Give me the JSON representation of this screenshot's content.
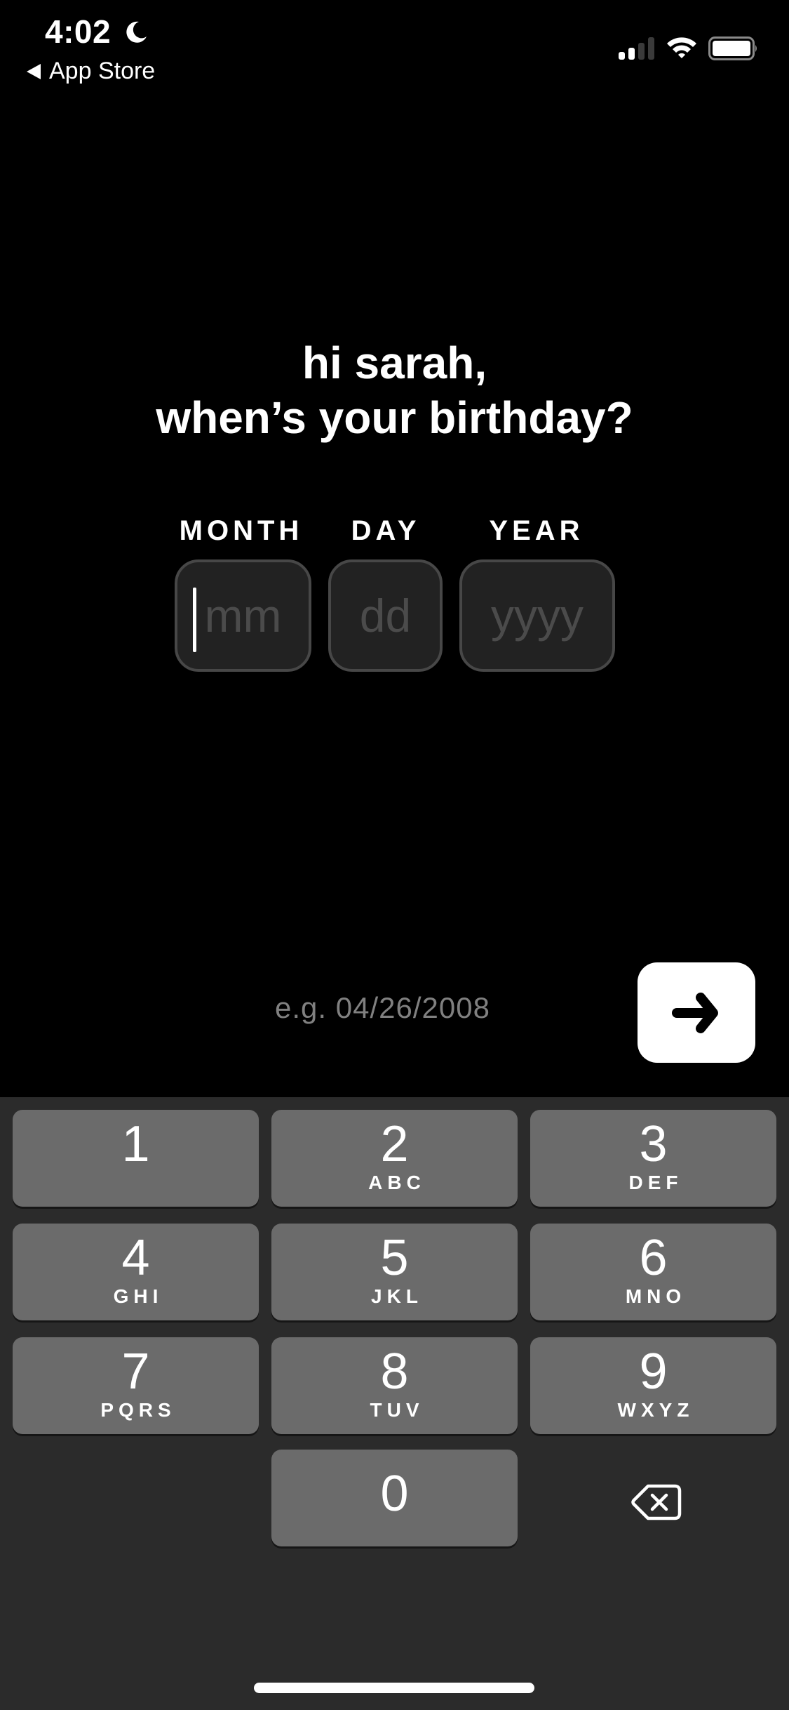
{
  "status_bar": {
    "time": "4:02",
    "back_label": "App Store",
    "focus_icon": "moon-icon",
    "signal_icon": "cellular-signal-icon",
    "wifi_icon": "wifi-icon",
    "battery_icon": "battery-icon"
  },
  "prompt": {
    "line1": "hi sarah,",
    "line2": "when’s your birthday?"
  },
  "fields": {
    "month": {
      "label": "MONTH",
      "placeholder": "mm",
      "value": ""
    },
    "day": {
      "label": "DAY",
      "placeholder": "dd",
      "value": ""
    },
    "year": {
      "label": "YEAR",
      "placeholder": "yyyy",
      "value": ""
    }
  },
  "hint": "e.g. 04/26/2008",
  "next_button": {
    "icon": "arrow-right-icon"
  },
  "keypad": {
    "keys": [
      {
        "num": "1",
        "letters": ""
      },
      {
        "num": "2",
        "letters": "ABC"
      },
      {
        "num": "3",
        "letters": "DEF"
      },
      {
        "num": "4",
        "letters": "GHI"
      },
      {
        "num": "5",
        "letters": "JKL"
      },
      {
        "num": "6",
        "letters": "MNO"
      },
      {
        "num": "7",
        "letters": "PQRS"
      },
      {
        "num": "8",
        "letters": "TUV"
      },
      {
        "num": "9",
        "letters": "WXYZ"
      },
      {
        "num": "0",
        "letters": ""
      }
    ],
    "delete_icon": "backspace-icon"
  },
  "colors": {
    "background": "#000000",
    "field_bg": "#222222",
    "field_border": "#474747",
    "placeholder": "#4b4b4b",
    "hint": "#808080",
    "keyboard_bg": "#2b2b2b",
    "key_bg": "#6b6b6b"
  }
}
